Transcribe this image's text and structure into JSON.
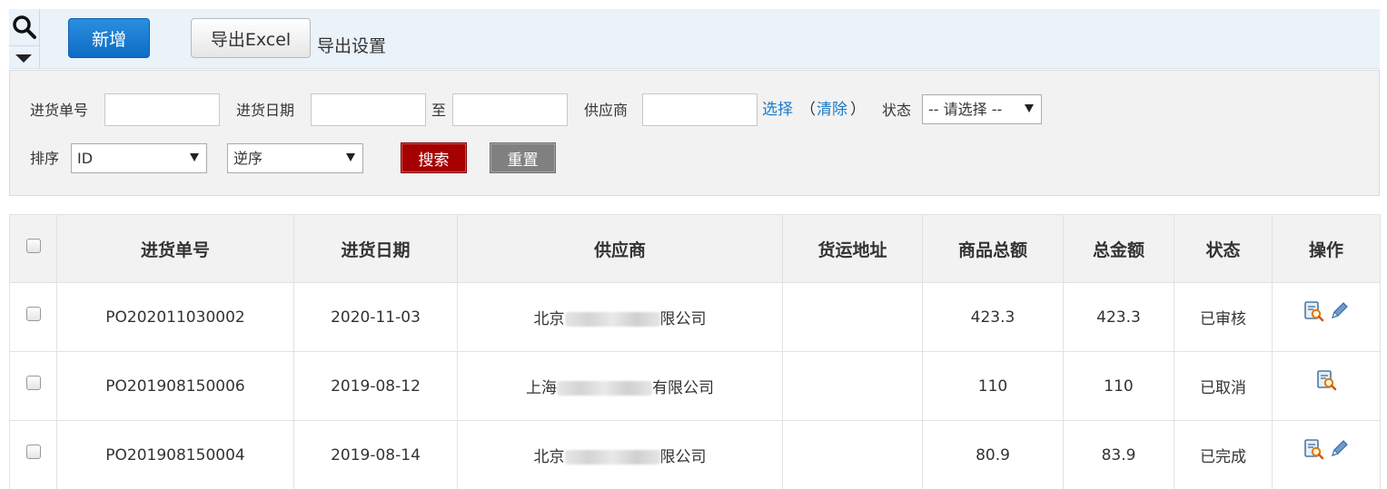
{
  "toolbar": {
    "add_label": "新增",
    "export_label": "导出Excel",
    "export_settings_label": "导出设置"
  },
  "filters": {
    "order_no_label": "进货单号",
    "order_no_value": "",
    "date_label": "进货日期",
    "date_from_value": "",
    "date_to_label": "至",
    "date_to_value": "",
    "supplier_label": "供应商",
    "supplier_value": "",
    "select_link": "选择",
    "clear_open": "（",
    "clear_link": "清除",
    "clear_close": "）",
    "status_label": "状态",
    "status_selected": "-- 请选择 --",
    "sort_label": "排序",
    "sort_field_selected": "ID",
    "sort_order_selected": "逆序",
    "search_label": "搜索",
    "reset_label": "重置"
  },
  "table": {
    "headers": [
      "进货单号",
      "进货日期",
      "供应商",
      "货运地址",
      "商品总额",
      "总金额",
      "状态",
      "操作"
    ],
    "rows": [
      {
        "order_no": "PO202011030002",
        "date": "2020-11-03",
        "supplier_prefix": "北京",
        "supplier_suffix": "限公司",
        "address": "",
        "goods_total": "423.3",
        "total": "423.3",
        "status": "已审核",
        "can_edit": true
      },
      {
        "order_no": "PO201908150006",
        "date": "2019-08-12",
        "supplier_prefix": "上海",
        "supplier_suffix": "有限公司",
        "address": "",
        "goods_total": "110",
        "total": "110",
        "status": "已取消",
        "can_edit": false
      },
      {
        "order_no": "PO201908150004",
        "date": "2019-08-14",
        "supplier_prefix": "北京",
        "supplier_suffix": "限公司",
        "address": "",
        "goods_total": "80.9",
        "total": "83.9",
        "status": "已完成",
        "can_edit": true
      }
    ]
  },
  "icons": {
    "search_toggle": "magnifier-icon",
    "collapse": "caret-down-icon",
    "view": "view-details-icon",
    "edit": "pencil-edit-icon"
  },
  "colors": {
    "primary_button": "#1a7ad4",
    "search_button": "#a60000",
    "reset_button": "#808080",
    "link": "#1a7ac8",
    "toolbar_bg": "#eaf2fa"
  }
}
